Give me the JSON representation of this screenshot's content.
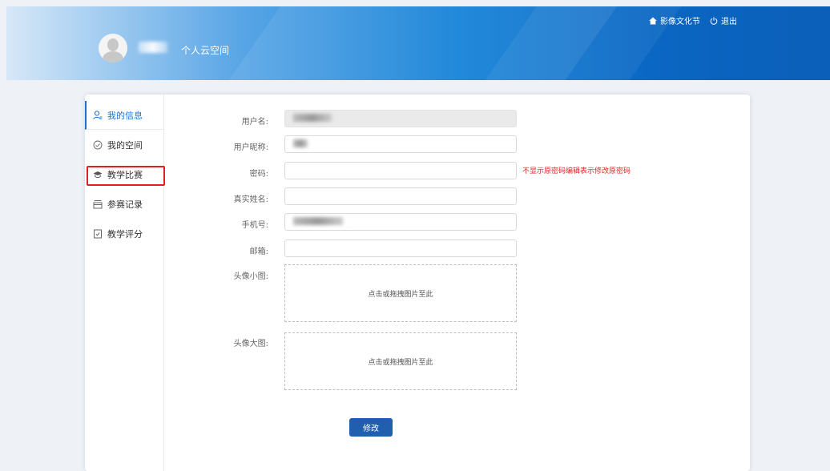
{
  "header": {
    "space_title": "个人云空间",
    "links": {
      "festival": "影像文化节",
      "logout": "退出"
    },
    "icons": {
      "home": "home-icon",
      "logout": "power-icon"
    }
  },
  "sidebar": {
    "items": [
      {
        "label": "我的信息",
        "icon": "user-icon",
        "active": true
      },
      {
        "label": "我的空间",
        "icon": "check-circle-icon"
      },
      {
        "label": "教学比赛",
        "icon": "graduation-cap-icon"
      },
      {
        "label": "参赛记录",
        "icon": "archive-icon"
      },
      {
        "label": "教学评分",
        "icon": "document-check-icon"
      }
    ]
  },
  "form": {
    "username_label": "用户名:",
    "nickname_label": "用户昵称:",
    "password_label": "密码:",
    "password_hint": "不显示原密码编辑表示修改原密码",
    "realname_label": "真实姓名:",
    "phone_label": "手机号:",
    "email_label": "邮箱:",
    "avatar_small_label": "头像小图:",
    "avatar_small_upload": "点击或拖拽图片至此",
    "avatar_large_label": "头像大图:",
    "avatar_large_upload": "点击或拖拽图片至此",
    "submit_label": "修改"
  },
  "colors": {
    "accent": "#1f6fcf",
    "button": "#1f5fae",
    "warning": "#e02525",
    "header_dark": "#0b5fb8"
  }
}
